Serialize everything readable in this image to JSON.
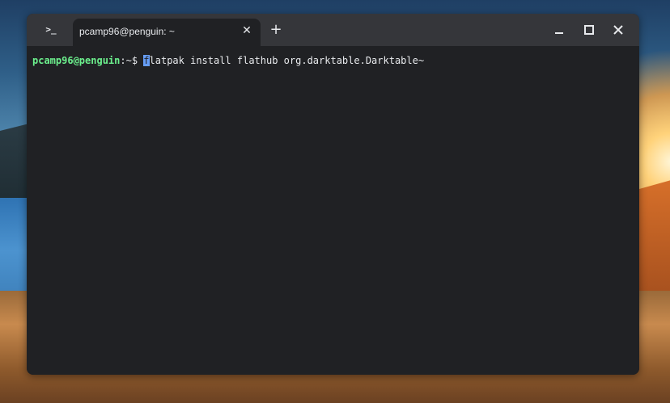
{
  "window": {
    "tab_title": "pcamp96@penguin: ~",
    "terminal_icon_glyph": ">_",
    "tab_close_glyph": "✕",
    "new_tab_glyph": "+"
  },
  "terminal": {
    "prompt_user": "pcamp96@penguin",
    "prompt_path": ":~$ ",
    "command_cursor_char": "f",
    "command_rest": "latpak install flathub org.darktable.Darktable~"
  },
  "colors": {
    "window_bg": "#202124",
    "titlebar_bg": "#35363a",
    "prompt_user": "#6cf08d",
    "cursor": "#669df6",
    "text": "#e8eaed"
  },
  "icons": {
    "app": "terminal-icon",
    "minimize": "minimize-icon",
    "maximize": "maximize-icon",
    "close": "close-icon"
  }
}
